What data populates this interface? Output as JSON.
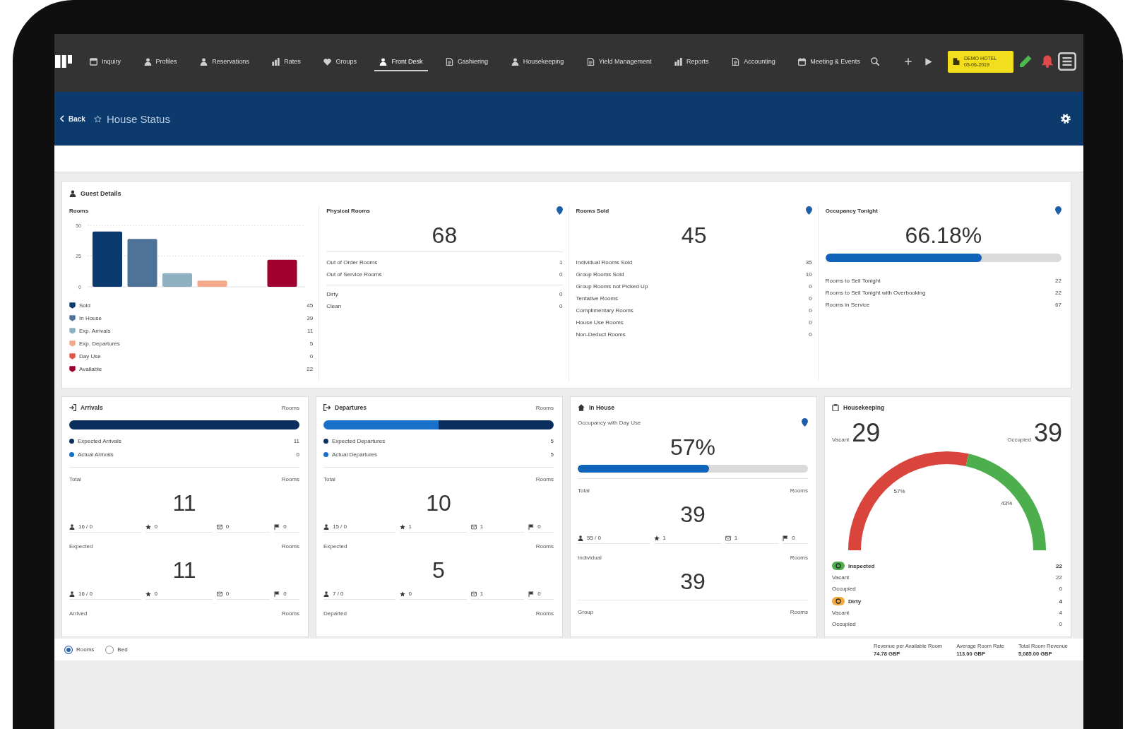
{
  "nav": {
    "items": [
      {
        "label": "Inquiry",
        "selected": false
      },
      {
        "label": "Profiles",
        "selected": false
      },
      {
        "label": "Reservations",
        "selected": false
      },
      {
        "label": "Rates",
        "selected": false
      },
      {
        "label": "Groups",
        "selected": false
      },
      {
        "label": "Front Desk",
        "selected": true
      },
      {
        "label": "Cashiering",
        "selected": false
      },
      {
        "label": "Housekeeping",
        "selected": false
      },
      {
        "label": "Yield Management",
        "selected": false
      },
      {
        "label": "Reports",
        "selected": false
      },
      {
        "label": "Accounting",
        "selected": false
      },
      {
        "label": "Meeting & Events",
        "selected": false
      }
    ],
    "property": {
      "name": "DEMO HOTEL",
      "date": "05-06-2019"
    }
  },
  "header": {
    "back": "Back",
    "title": "House Status"
  },
  "summary": {
    "title": "Guest Details",
    "rooms": {
      "chart_data": {
        "type": "bar",
        "title": "Rooms",
        "values": [
          45,
          39,
          11,
          5,
          0,
          22
        ],
        "ylim": [
          0,
          50
        ],
        "yticks": [
          0,
          25,
          50
        ]
      },
      "legend": [
        {
          "label": "Sold",
          "value": "45",
          "color": "#0b3a6e"
        },
        {
          "label": "In House",
          "value": "39",
          "color": "#4f7398"
        },
        {
          "label": "Exp. Arrivals",
          "value": "11",
          "color": "#8fb0c0"
        },
        {
          "label": "Exp. Departures",
          "value": "5",
          "color": "#f5a98c"
        },
        {
          "label": "Day Use",
          "value": "0",
          "color": "#e2574c"
        },
        {
          "label": "Available",
          "value": "22",
          "color": "#a0002f"
        }
      ]
    },
    "tiles": [
      {
        "title": "Physical Rooms",
        "value": "68",
        "groups": [
          {
            "rows": [
              {
                "label": "Out of Order Rooms",
                "value": "1"
              },
              {
                "label": "Out of Service Rooms",
                "value": "0"
              }
            ]
          },
          {
            "rows": [
              {
                "label": "Dirty",
                "value": "0"
              },
              {
                "label": "Clean",
                "value": "0"
              }
            ]
          }
        ]
      },
      {
        "title": "Rooms Sold",
        "value": "45",
        "groups": [
          {
            "rows": [
              {
                "label": "Individual Rooms Sold",
                "value": "35"
              },
              {
                "label": "Group Rooms Sold",
                "value": "10"
              },
              {
                "label": "Group Rooms not Picked Up",
                "value": "0"
              },
              {
                "label": "Tentative Rooms",
                "value": "0"
              },
              {
                "label": "Complimentary Rooms",
                "value": "0"
              },
              {
                "label": "House Use Rooms",
                "value": "0"
              },
              {
                "label": "Non-Deduct Rooms",
                "value": "0"
              }
            ]
          }
        ]
      },
      {
        "title": "Occupancy Tonight",
        "value": "66.18%",
        "level": 0.6618,
        "groups": [
          {
            "rows": [
              {
                "label": "Rooms to Sell Tonight",
                "value": "22"
              },
              {
                "label": "Rooms to Sell Tonight with Overbooking",
                "value": "22"
              },
              {
                "label": "Rooms in Service",
                "value": "67"
              }
            ]
          }
        ]
      }
    ]
  },
  "movement": [
    {
      "title": "Arrivals",
      "unit": "Rooms",
      "legend": [
        {
          "label": "Expected Arrivals",
          "value": "11",
          "color": "#0a2f5e"
        },
        {
          "label": "Actual Arrivals",
          "value": "0",
          "color": "#1a6fc9"
        }
      ],
      "sections": [
        {
          "label": "Total",
          "unit": "Rooms",
          "value": "11",
          "stats": [
            "16 / 0",
            "0",
            "0",
            "0"
          ]
        },
        {
          "label": "Expected",
          "unit": "Rooms",
          "value": "11",
          "stats": [
            "16 / 0",
            "0",
            "0",
            "0"
          ]
        },
        {
          "label": "Arrived",
          "unit": "Rooms"
        }
      ]
    },
    {
      "title": "Departures",
      "unit": "Rooms",
      "legend": [
        {
          "label": "Expected Departures",
          "value": "5",
          "color": "#0a2f5e"
        },
        {
          "label": "Actual Departures",
          "value": "5",
          "color": "#1a6fc9"
        }
      ],
      "sections": [
        {
          "label": "Total",
          "unit": "Rooms",
          "value": "10",
          "stats": [
            "15 / 0",
            "1",
            "1",
            "0"
          ]
        },
        {
          "label": "Expected",
          "unit": "Rooms",
          "value": "5",
          "stats": [
            "7 / 0",
            "0",
            "1",
            "0"
          ]
        },
        {
          "label": "Departed",
          "unit": "Rooms"
        }
      ]
    }
  ],
  "in_house": {
    "title": "In House",
    "subtitle": "Occupancy with Day Use",
    "value": "57%",
    "level": 0.57,
    "sections": [
      {
        "label": "Total",
        "unit": "Rooms",
        "value": "39",
        "stats": [
          "55 / 0",
          "1",
          "1",
          "0"
        ]
      },
      {
        "label": "Individual",
        "unit": "Rooms",
        "value": "39"
      },
      {
        "label": "Group",
        "unit": "Rooms"
      }
    ]
  },
  "housekeeping": {
    "title": "Housekeeping",
    "vacant": {
      "label": "Vacant",
      "value": "29"
    },
    "occupied": {
      "label": "Occupied",
      "value": "39"
    },
    "gauge": {
      "chart_data": {
        "type": "donut",
        "values": [
          57,
          43
        ],
        "value_labels": [
          "57%",
          "43%"
        ]
      },
      "segments": [
        {
          "color": "#d9443c"
        },
        {
          "color": "#4cae4c"
        }
      ]
    },
    "legend": [
      {
        "label": "Inspected",
        "value": "22",
        "color": "#4cae4c",
        "rows": [
          {
            "label": "Vacant",
            "value": "22"
          },
          {
            "label": "Occupied",
            "value": "0"
          }
        ]
      },
      {
        "label": "Dirty",
        "value": "4",
        "color": "#f2a93b",
        "rows": [
          {
            "label": "Vacant",
            "value": "4"
          },
          {
            "label": "Occupied",
            "value": "0"
          }
        ]
      }
    ]
  },
  "footer": {
    "options": [
      {
        "label": "Rooms",
        "selected": true
      },
      {
        "label": "Bed",
        "selected": false
      }
    ],
    "stats": [
      {
        "label": "Revenue per Available Room",
        "value": "74.78 GBP"
      },
      {
        "label": "Average Room Rate",
        "value": "113.00 GBP"
      },
      {
        "label": "Total Room Revenue",
        "value": "5,085.00 GBP"
      }
    ]
  }
}
